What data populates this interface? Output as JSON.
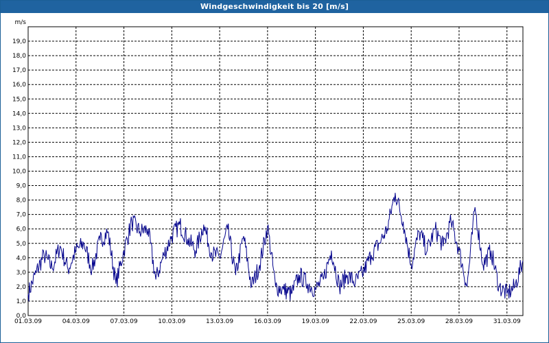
{
  "window": {
    "title": "Windgeschwindigkeit bis 20 [m/s]",
    "title_bar_color": "#1f63a0"
  },
  "chart_data": {
    "type": "line",
    "title": "Windgeschwindigkeit bis 20 [m/s]",
    "ylabel": "m/s",
    "xlabel": "",
    "ylim": [
      0,
      20
    ],
    "xlim": [
      "01.03.09",
      "01.04.09"
    ],
    "y_ticks": [
      "0,0",
      "1,0",
      "2,0",
      "3,0",
      "4,0",
      "5,0",
      "6,0",
      "7,0",
      "8,0",
      "9,0",
      "10,0",
      "11,0",
      "12,0",
      "13,0",
      "14,0",
      "15,0",
      "16,0",
      "17,0",
      "18,0",
      "19,0"
    ],
    "x_ticks": [
      "01.03.09",
      "04.03.09",
      "07.03.09",
      "10.03.09",
      "13.03.09",
      "16.03.09",
      "19.03.09",
      "22.03.09",
      "25.03.09",
      "28.03.09",
      "31.03.09"
    ],
    "grid": true,
    "line_color": "#00008b",
    "series": [
      {
        "x": [
          "01.03.09",
          "01.03.09 12h",
          "02.03.09",
          "02.03.09 12h",
          "03.03.09",
          "03.03.09 12h",
          "04.03.09",
          "04.03.09 12h",
          "05.03.09",
          "05.03.09 12h",
          "06.03.09",
          "06.03.09 12h",
          "07.03.09",
          "07.03.09 12h",
          "08.03.09",
          "08.03.09 12h",
          "09.03.09",
          "09.03.09 12h",
          "10.03.09",
          "10.03.09 12h",
          "11.03.09",
          "11.03.09 12h",
          "12.03.09",
          "12.03.09 12h",
          "13.03.09",
          "13.03.09 12h",
          "14.03.09",
          "14.03.09 12h",
          "15.03.09",
          "15.03.09 12h",
          "16.03.09",
          "16.03.09 12h",
          "17.03.09",
          "17.03.09 12h",
          "18.03.09",
          "18.03.09 12h",
          "19.03.09",
          "19.03.09 12h",
          "20.03.09",
          "20.03.09 12h",
          "21.03.09",
          "21.03.09 12h",
          "22.03.09",
          "22.03.09 12h",
          "23.03.09",
          "23.03.09 12h",
          "24.03.09",
          "24.03.09 12h",
          "25.03.09",
          "25.03.09 12h",
          "26.03.09",
          "26.03.09 12h",
          "27.03.09",
          "27.03.09 12h",
          "28.03.09",
          "28.03.09 12h",
          "29.03.09",
          "29.03.09 12h",
          "30.03.09",
          "30.03.09 12h",
          "31.03.09",
          "31.03.09 12h",
          "01.04.09"
        ],
        "values": [
          1.5,
          3.0,
          4.2,
          3.3,
          4.8,
          3.2,
          4.5,
          5.0,
          3.2,
          5.2,
          5.8,
          2.2,
          4.5,
          6.5,
          5.8,
          6.0,
          2.5,
          4.2,
          5.5,
          6.3,
          5.3,
          4.5,
          6.3,
          4.3,
          4.0,
          6.0,
          2.8,
          5.5,
          2.0,
          3.5,
          6.2,
          2.0,
          1.8,
          1.5,
          2.8,
          2.2,
          1.8,
          2.5,
          4.5,
          2.0,
          2.8,
          2.3,
          3.0,
          4.2,
          5.0,
          6.0,
          8.5,
          6.5,
          3.5,
          5.8,
          4.5,
          6.0,
          4.8,
          6.5,
          4.5,
          2.0,
          7.5,
          3.5,
          4.5,
          2.0,
          1.5,
          2.0,
          3.8
        ]
      }
    ]
  }
}
